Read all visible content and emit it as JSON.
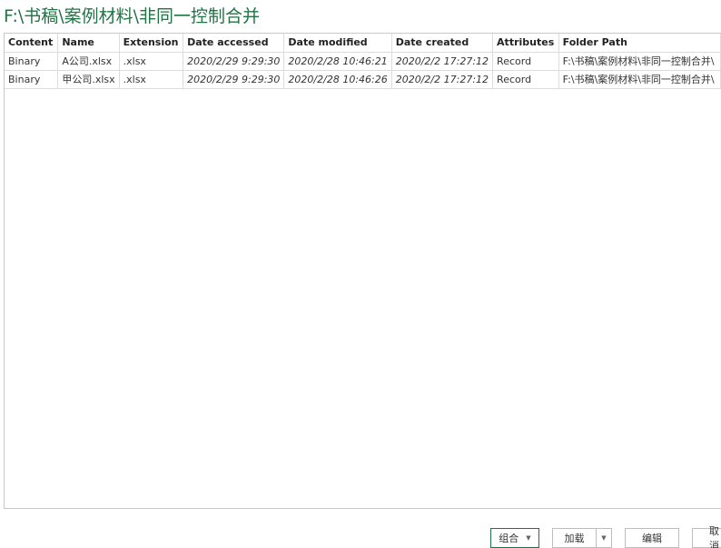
{
  "title": "F:\\书稿\\案例材料\\非同一控制合并",
  "table": {
    "columns": [
      "Content",
      "Name",
      "Extension",
      "Date accessed",
      "Date modified",
      "Date created",
      "Attributes",
      "Folder Path"
    ],
    "rows": [
      [
        "Binary",
        "A公司.xlsx",
        ".xlsx",
        "2020/2/29 9:29:30",
        "2020/2/28 10:46:21",
        "2020/2/2 17:27:12",
        "Record",
        "F:\\书稿\\案例材料\\非同一控制合并\\"
      ],
      [
        "Binary",
        "甲公司.xlsx",
        ".xlsx",
        "2020/2/29 9:29:30",
        "2020/2/28 10:46:26",
        "2020/2/2 17:27:12",
        "Record",
        "F:\\书稿\\案例材料\\非同一控制合并\\"
      ]
    ]
  },
  "buttons": {
    "combine": "组合",
    "load": "加载",
    "edit": "编辑",
    "cancel": "取消"
  },
  "icons": {
    "dropdown": "chevron-down-icon"
  },
  "colors": {
    "title": "#217346",
    "accent_border": "#217346"
  }
}
